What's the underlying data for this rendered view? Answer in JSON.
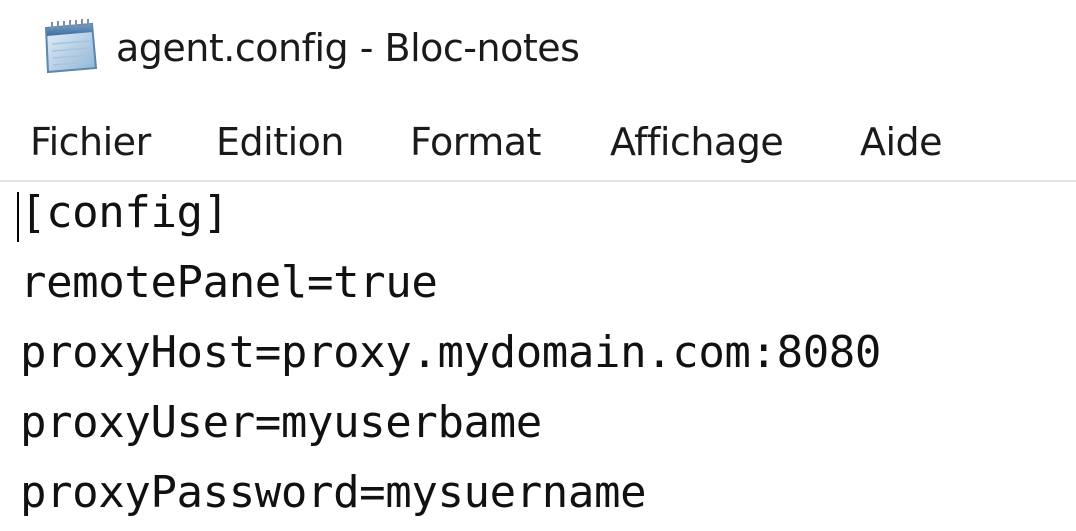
{
  "window": {
    "title": "agent.config - Bloc-notes",
    "icon": "notepad-icon"
  },
  "menu": {
    "items": [
      {
        "label": "Fichier"
      },
      {
        "label": "Edition"
      },
      {
        "label": "Format"
      },
      {
        "label": "Affichage"
      },
      {
        "label": "Aide"
      }
    ]
  },
  "editor": {
    "lines": [
      "[config]",
      "remotePanel=true",
      "proxyHost=proxy.mydomain.com:8080",
      "proxyUser=myuserbame",
      "proxyPassword=mysuername"
    ]
  }
}
